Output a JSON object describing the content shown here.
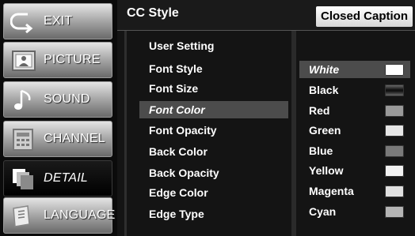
{
  "sidebar": {
    "items": [
      {
        "label": "EXIT"
      },
      {
        "label": "PICTURE"
      },
      {
        "label": "SOUND"
      },
      {
        "label": "CHANNEL"
      },
      {
        "label": "DETAIL"
      },
      {
        "label": "LANGUAGE"
      }
    ]
  },
  "header": {
    "title": "CC Style",
    "badge": "Closed Caption"
  },
  "menu": {
    "items": [
      {
        "label": "User Setting"
      },
      {
        "label": "Font Style"
      },
      {
        "label": "Font Size"
      },
      {
        "label": "Font Color"
      },
      {
        "label": "Font Opacity"
      },
      {
        "label": "Back Color"
      },
      {
        "label": "Back Opacity"
      },
      {
        "label": "Edge Color"
      },
      {
        "label": "Edge Type"
      }
    ],
    "selected": "Font Color"
  },
  "values": {
    "items": [
      {
        "label": "White",
        "swatch": "#ffffff"
      },
      {
        "label": "Black",
        "swatch": "#222222"
      },
      {
        "label": "Red",
        "swatch": "#9a9a9a"
      },
      {
        "label": "Green",
        "swatch": "#e6e6e6"
      },
      {
        "label": "Blue",
        "swatch": "#7a7a7a"
      },
      {
        "label": "Yellow",
        "swatch": "#f2f2f2"
      },
      {
        "label": "Magenta",
        "swatch": "#e0e0e0"
      },
      {
        "label": "Cyan",
        "swatch": "#b5b5b5"
      }
    ],
    "selected": "White"
  },
  "colors": {
    "highlight": "#4c4c4c",
    "panel": "#141414",
    "background": "#0b0b0b"
  },
  "icons": {
    "exit": "exit-arrow-icon",
    "picture": "picture-icon",
    "sound": "speaker-icon",
    "channel": "channel-grid-icon",
    "detail": "detail-pages-icon",
    "language": "language-icon"
  }
}
